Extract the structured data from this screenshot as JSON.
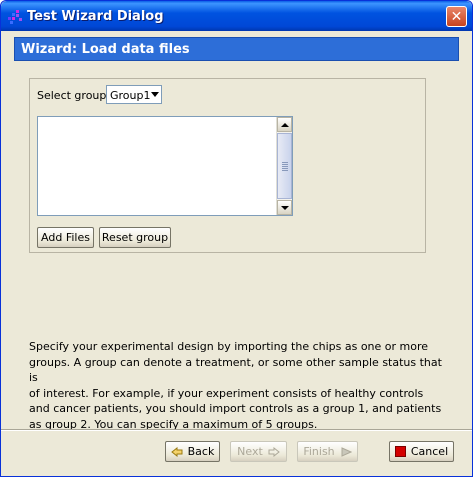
{
  "window": {
    "title": "Test Wizard Dialog",
    "close_glyph": "✕"
  },
  "header": {
    "title": "Wizard: Load data files"
  },
  "group_panel": {
    "select_label": "Select group:",
    "selected_group": "Group1",
    "add_files_label": "Add Files",
    "reset_group_label": "Reset group"
  },
  "description": "Specify your experimental design by importing the chips as one or more\ngroups. A group can denote a treatment, or some other sample status that is\nof interest. For example, if your experiment consists of healthy controls\nand cancer patients, you should import controls as a group 1, and patients\nas group 2. You can specify a maximum of 5 groups.",
  "footer": {
    "back_label": "Back",
    "next_label": "Next",
    "finish_label": "Finish",
    "cancel_label": "Cancel"
  },
  "colors": {
    "title_bar": "#0053e0",
    "header_bg": "#2d6ed8",
    "window_bg": "#ece9d8"
  },
  "icons": [
    "app-icon",
    "close-icon",
    "dropdown-arrow-icon",
    "back-arrow-icon",
    "next-arrow-icon",
    "finish-arrow-icon",
    "cancel-icon"
  ]
}
